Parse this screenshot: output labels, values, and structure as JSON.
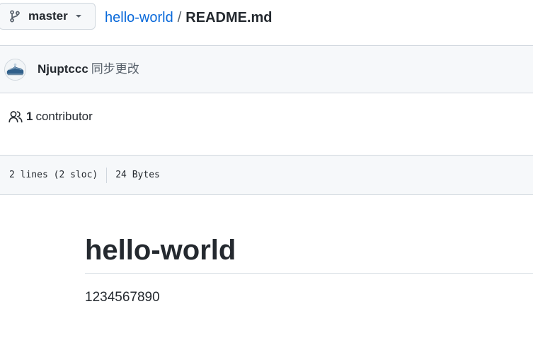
{
  "branch": {
    "name": "master",
    "branch_icon": "git-branch-icon",
    "caret_icon": "caret-down-icon"
  },
  "breadcrumb": {
    "repo": "hello-world",
    "separator": "/",
    "file": "README.md"
  },
  "commit": {
    "author": "Njuptccc",
    "message": "同步更改"
  },
  "contributors": {
    "icon": "people-icon",
    "count": "1",
    "label": "contributor"
  },
  "file_info": {
    "lines": "2 lines (2 sloc)",
    "size": "24 Bytes"
  },
  "readme": {
    "heading": "hello-world",
    "paragraph": "1234567890"
  },
  "colors": {
    "link": "#0969da",
    "text": "#24292f",
    "muted": "#57606a",
    "border": "#d0d7de",
    "subtle_bg": "#f6f8fa"
  }
}
